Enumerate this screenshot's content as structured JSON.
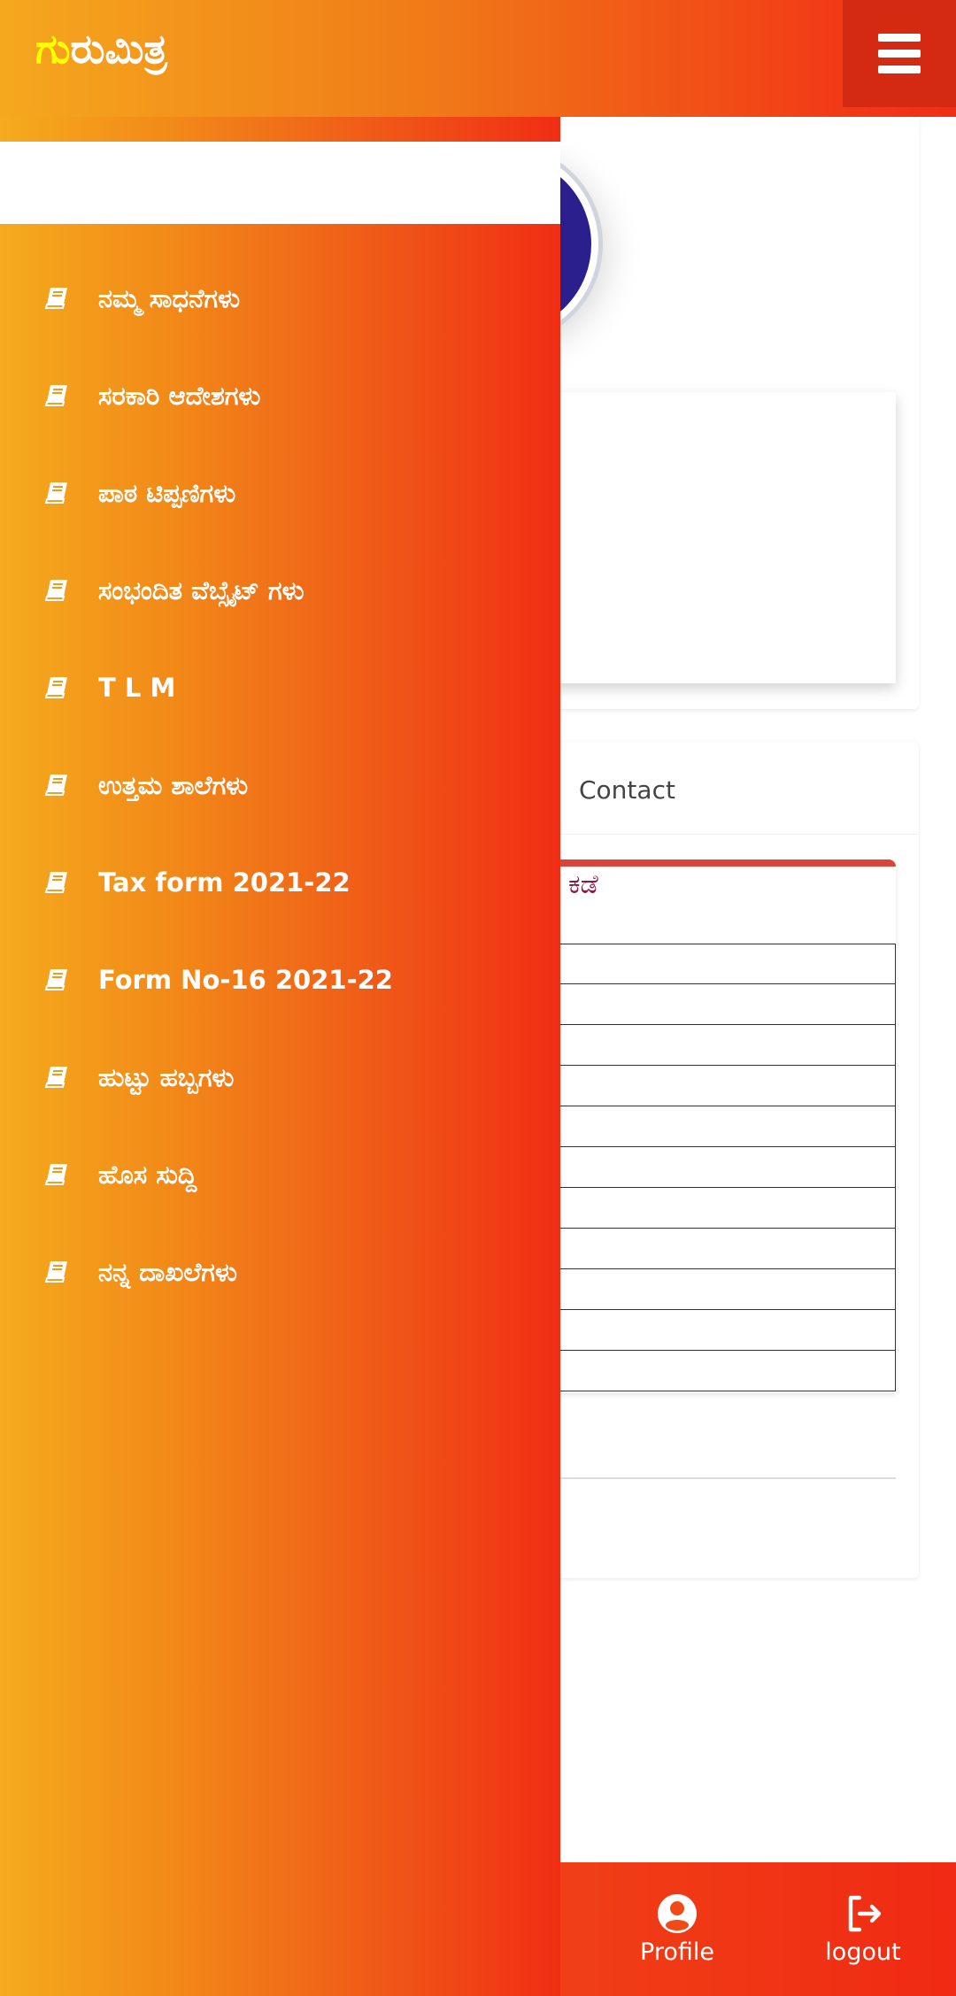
{
  "header": {
    "brand_highlight": "ಗು",
    "brand_rest": "ರುಮಿತ್ರ",
    "menu_icon": "hamburger-icon"
  },
  "colors": {
    "header_start": "#f5a81e",
    "header_end": "#f02f14",
    "brand_highlight": "#ffff00",
    "accent_red": "#d9453a",
    "title_maroon": "#8a1a4a"
  },
  "drawer": {
    "items": [
      {
        "label": "ನಮ್ಮ ಸಾಧನೆಗಳು",
        "icon": "book-icon"
      },
      {
        "label": "ಸರಕಾರಿ ಆದೇಶಗಳು",
        "icon": "book-icon"
      },
      {
        "label": "ಪಾಠ ಟಿಪ್ಪಣಿಗಳು",
        "icon": "book-icon"
      },
      {
        "label": "ಸಂಭಂದಿತ ವೆಬ್ಸೈಟ್ ಗಳು",
        "icon": "book-icon"
      },
      {
        "label": "T L M",
        "icon": "book-icon"
      },
      {
        "label": "ಉತ್ತಮ ಶಾಲೆಗಳು",
        "icon": "book-icon"
      },
      {
        "label": "Tax form 2021-22",
        "icon": "book-icon"
      },
      {
        "label": "Form No-16 2021-22",
        "icon": "book-icon"
      },
      {
        "label": "ಹುಟ್ಟು ಹಬ್ಬಗಳು",
        "icon": "book-icon"
      },
      {
        "label": "ಹೊಸ ಸುದ್ದಿ",
        "icon": "book-icon"
      },
      {
        "label": "ನನ್ನ ದಾಖಲೆಗಳು",
        "icon": "book-icon"
      }
    ]
  },
  "main": {
    "tab_contact": "Contact",
    "box_title": "ಕಡೆ",
    "table_rows": 11
  },
  "bottom_nav": {
    "profile": "Profile",
    "logout": "logout"
  }
}
